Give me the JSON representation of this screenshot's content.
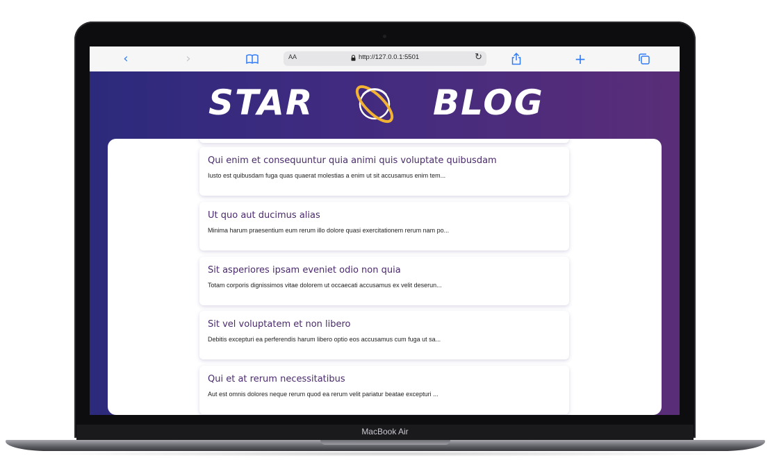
{
  "browser": {
    "url": "http://127.0.0.1:5501",
    "text_size_label": "AA",
    "icons": [
      "back-chevron-icon",
      "forward-chevron-icon",
      "bookmarks-book-icon",
      "lock-icon",
      "reload-icon",
      "share-icon",
      "plus-icon",
      "tabs-icon"
    ]
  },
  "blog": {
    "logo_left": "STAR",
    "logo_right": "BLOG",
    "posts": [
      {
        "title": "Qui enim et consequuntur quia animi quis voluptate quibusdam",
        "excerpt": "Iusto est quibusdam fuga quas quaerat molestias a enim ut sit accusamus enim tem..."
      },
      {
        "title": "Ut quo aut ducimus alias",
        "excerpt": "Minima harum praesentium eum rerum illo dolore quasi exercitationem rerum nam po..."
      },
      {
        "title": "Sit asperiores ipsam eveniet odio non quia",
        "excerpt": "Totam corporis dignissimos vitae dolorem ut occaecati accusamus ex velit deserun..."
      },
      {
        "title": "Sit vel voluptatem et non libero",
        "excerpt": "Debitis excepturi ea perferendis harum libero optio eos accusamus cum fuga ut sa..."
      },
      {
        "title": "Qui et at rerum necessitatibus",
        "excerpt": "Aut est omnis dolores neque rerum quod ea rerum velit pariatur beatae excepturi ..."
      }
    ]
  },
  "device": {
    "model_label": "MacBook Air"
  },
  "colors": {
    "accent": "#2f7cf6",
    "header_gradient_start": "#2c2a7c",
    "header_gradient_end": "#5a2d78",
    "planet_ring": "#f2b233",
    "post_title": "#4a2a6c"
  }
}
